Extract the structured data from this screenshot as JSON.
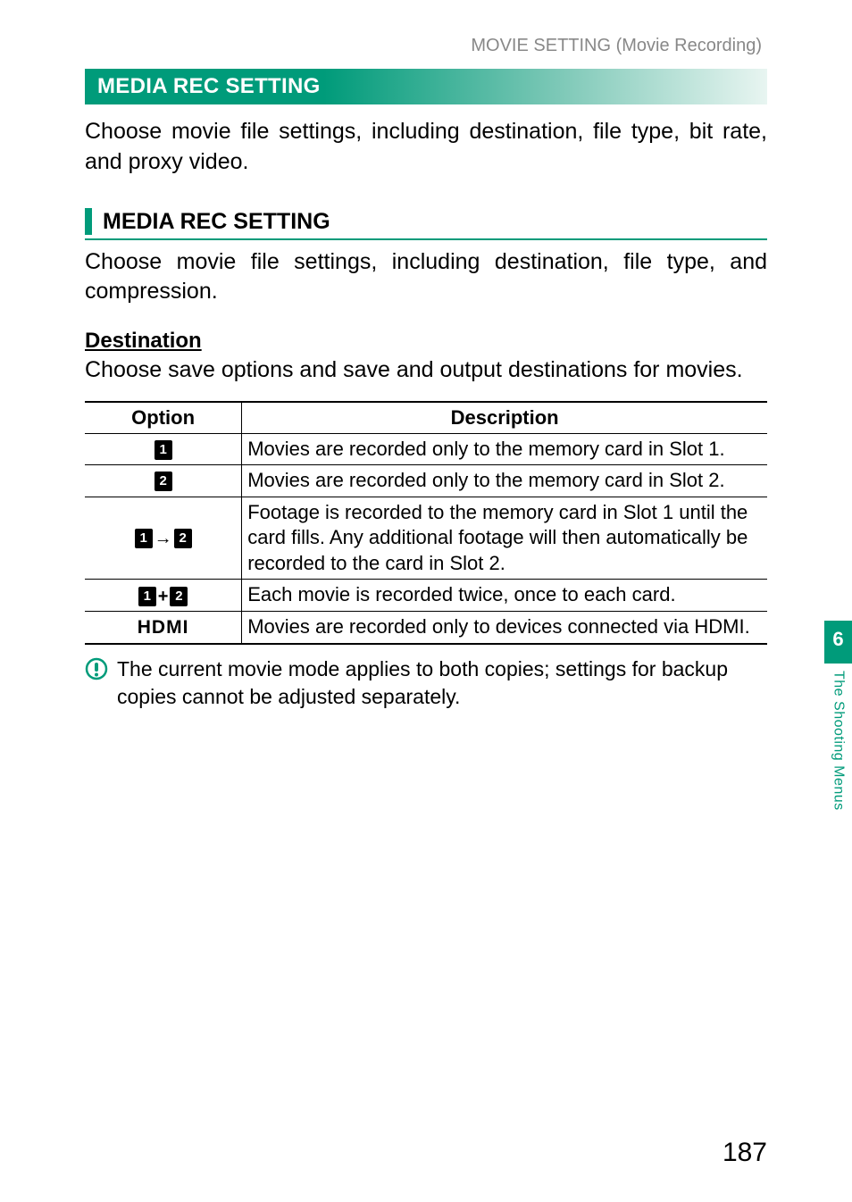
{
  "breadcrumb": "MOVIE SETTING (Movie Recording)",
  "section_title": "MEDIA REC SETTING",
  "intro_text": "Choose movie file settings, including destination, file type, bit rate, and proxy video.",
  "sub_heading": "MEDIA REC SETTING",
  "sub_intro": "Choose movie file settings, including destination, file type, and compression.",
  "dest_heading": "Destination",
  "dest_intro": "Choose save options and save and output destinations for movies.",
  "table": {
    "headers": {
      "option": "Option",
      "description": "Description"
    },
    "rows": [
      {
        "option_type": "slot1",
        "description": "Movies are recorded only to the memory card in Slot 1."
      },
      {
        "option_type": "slot2",
        "description": "Movies are recorded only to the memory card in Slot 2."
      },
      {
        "option_type": "slot1_to_2",
        "description": "Footage is recorded to the memory card in Slot 1 until the card fills. Any additional footage will then automatically be recorded to the card in Slot 2."
      },
      {
        "option_type": "slot1_plus_2",
        "description": "Each movie is recorded twice, once to each card."
      },
      {
        "option_type": "hdmi",
        "option_label": "HDMI",
        "description": "Movies are recorded only to devices connected via HDMI."
      }
    ]
  },
  "note_text": "The current movie mode applies to both copies; settings for backup copies cannot be adjusted separately.",
  "side_tab": {
    "number": "6",
    "label": "The Shooting Menus"
  },
  "page_number": "187",
  "slot_labels": {
    "one": "1",
    "two": "2"
  }
}
